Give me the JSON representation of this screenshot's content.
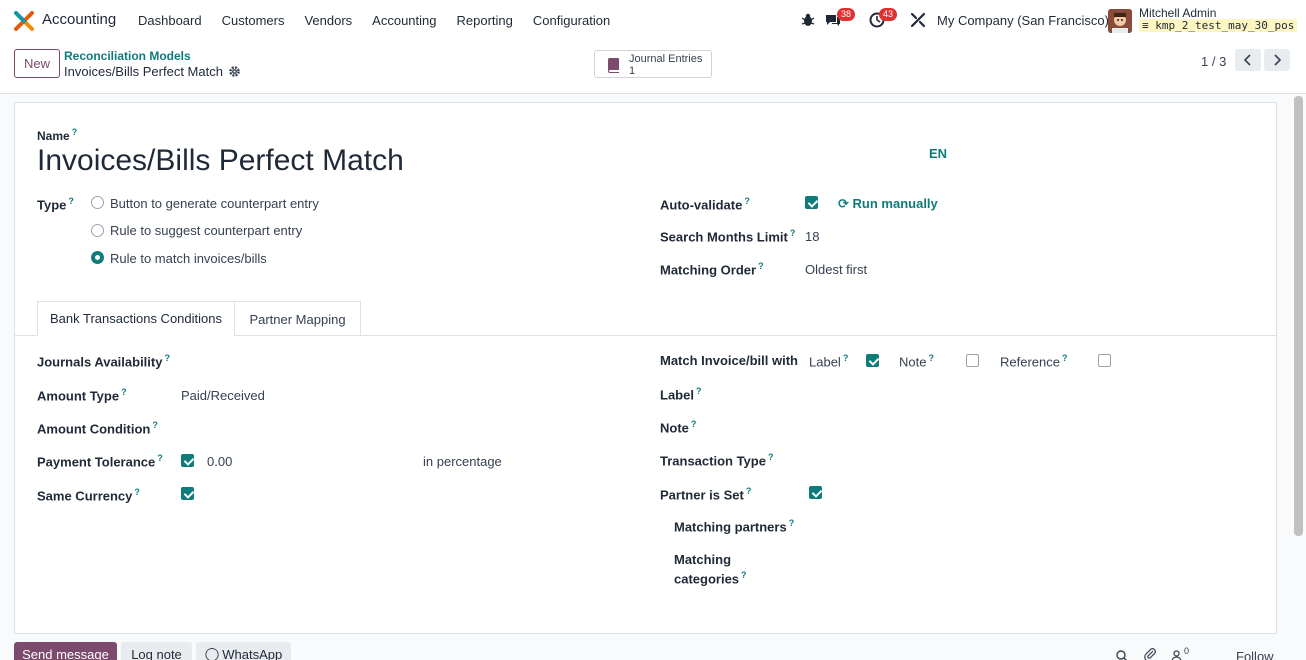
{
  "navbar": {
    "app_name": "Accounting",
    "menu": [
      "Dashboard",
      "Customers",
      "Vendors",
      "Accounting",
      "Reporting",
      "Configuration"
    ],
    "messages_count": "38",
    "activities_count": "43",
    "company": "My Company (San Francisco)",
    "user_name": "Mitchell Admin",
    "database": "kmp_2_test_may_30_pos"
  },
  "control_panel": {
    "new_label": "New",
    "breadcrumb_parent": "Reconciliation Models",
    "breadcrumb_current": "Invoices/Bills Perfect Match",
    "smart_button_label": "Journal Entries",
    "smart_button_count": "1",
    "pager": "1 / 3"
  },
  "form": {
    "name_label": "Name",
    "name_value": "Invoices/Bills Perfect Match",
    "lang": "EN",
    "type_label": "Type",
    "type_options": [
      {
        "label": "Button to generate counterpart entry",
        "selected": false
      },
      {
        "label": "Rule to suggest counterpart entry",
        "selected": false
      },
      {
        "label": "Rule to match invoices/bills",
        "selected": true
      }
    ],
    "auto_validate_label": "Auto-validate",
    "auto_validate_checked": true,
    "run_manually": "Run manually",
    "search_months_label": "Search Months Limit",
    "search_months_value": "18",
    "matching_order_label": "Matching Order",
    "matching_order_value": "Oldest first"
  },
  "tabs": [
    "Bank Transactions Conditions",
    "Partner Mapping"
  ],
  "conditions": {
    "journals_label": "Journals Availability",
    "amount_type_label": "Amount Type",
    "amount_type_value": "Paid/Received",
    "amount_condition_label": "Amount Condition",
    "payment_tolerance_label": "Payment Tolerance",
    "payment_tolerance_value": "0.00",
    "payment_tolerance_unit": "in percentage",
    "same_currency_label": "Same Currency",
    "match_label": "Match Invoice/bill with",
    "match_label_opt": "Label",
    "match_note_opt": "Note",
    "match_reference_opt": "Reference",
    "label_label": "Label",
    "note_label": "Note",
    "transaction_type_label": "Transaction Type",
    "partner_set_label": "Partner is Set",
    "matching_partners_label": "Matching partners",
    "matching_categories_line1": "Matching",
    "matching_categories_line2": "categories"
  },
  "chatter": {
    "send_message": "Send message",
    "log_note": "Log note",
    "whatsapp": "WhatsApp",
    "followers_count": "0",
    "follow": "Follow"
  },
  "colors": {
    "primary": "#7c4a6c",
    "teal": "#0e7c7b",
    "badge": "#e03131"
  }
}
